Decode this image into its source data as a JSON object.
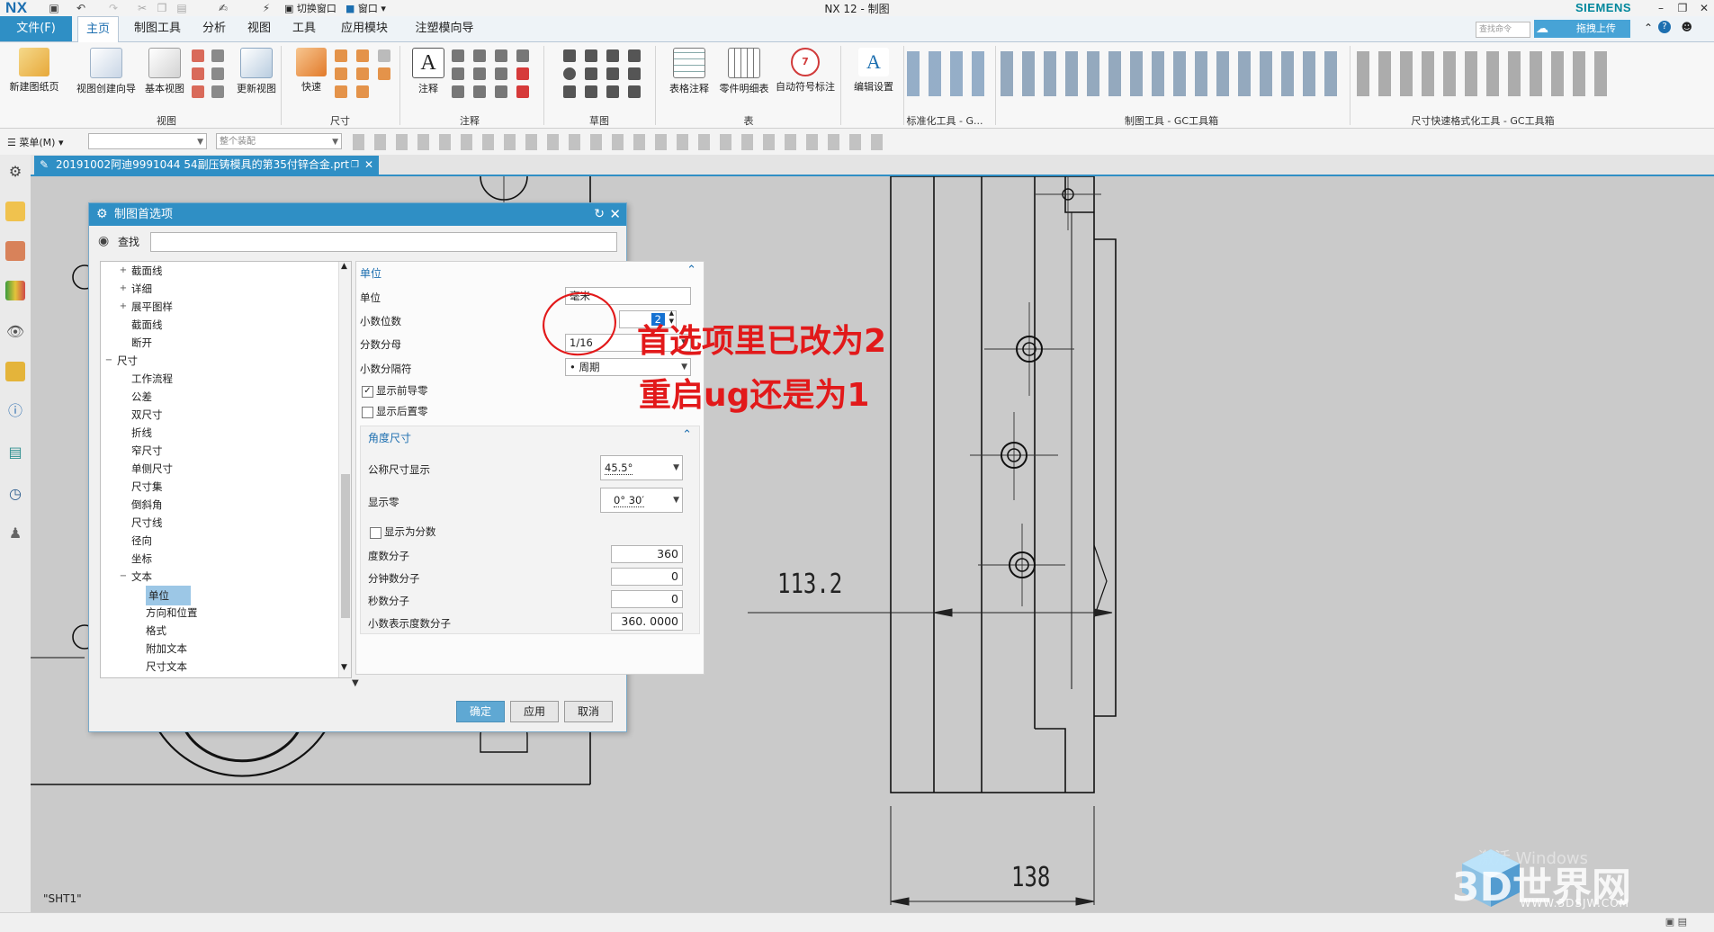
{
  "app": {
    "logo": "NX",
    "title": "NX 12 - 制图",
    "brand": "SIEMENS",
    "search_placeholder": "查找命令",
    "upload_label": "拖拽上传"
  },
  "menu": {
    "file": "文件(F)",
    "tabs": [
      "主页",
      "制图工具",
      "分析",
      "视图",
      "工具",
      "应用模块",
      "注塑模向导"
    ]
  },
  "quick_access": {
    "switch_window": "切换窗口",
    "window": "窗口"
  },
  "ribbon": {
    "items": [
      "新建图纸页",
      "视图创建向导",
      "基本视图",
      "更新视图",
      "快速",
      "注释",
      "表格注释",
      "零件明细表",
      "自动符号标注",
      "编辑设置"
    ],
    "groups": [
      "视图",
      "尺寸",
      "注释",
      "草图",
      "表",
      "标准化工具 - G...",
      "制图工具 - GC工具箱",
      "尺寸快速格式化工具 - GC工具箱"
    ]
  },
  "selbar": {
    "menu": "菜单(M)",
    "filter_value": "",
    "assembly_value": "整个装配"
  },
  "doc_tab": {
    "name": "20191002阿迪9991044  54副压铸模具的第35付锌合金.prt"
  },
  "drawing": {
    "sheet": "\"SHT1\"",
    "dim1": "113.2",
    "dim2": "138"
  },
  "dialog": {
    "title": "制图首选项",
    "find_label": "查找",
    "tree": [
      {
        "label": "截面线",
        "level": 2,
        "toggle": "+"
      },
      {
        "label": "详细",
        "level": 2,
        "toggle": "+"
      },
      {
        "label": "展平图样",
        "level": 2,
        "toggle": "+"
      },
      {
        "label": "截面线",
        "level": 2,
        "toggle": ""
      },
      {
        "label": "断开",
        "level": 2,
        "toggle": ""
      },
      {
        "label": "尺寸",
        "level": 1,
        "toggle": "−"
      },
      {
        "label": "工作流程",
        "level": 2,
        "toggle": ""
      },
      {
        "label": "公差",
        "level": 2,
        "toggle": ""
      },
      {
        "label": "双尺寸",
        "level": 2,
        "toggle": ""
      },
      {
        "label": "折线",
        "level": 2,
        "toggle": ""
      },
      {
        "label": "窄尺寸",
        "level": 2,
        "toggle": ""
      },
      {
        "label": "单侧尺寸",
        "level": 2,
        "toggle": ""
      },
      {
        "label": "尺寸集",
        "level": 2,
        "toggle": ""
      },
      {
        "label": "倒斜角",
        "level": 2,
        "toggle": ""
      },
      {
        "label": "尺寸线",
        "level": 2,
        "toggle": ""
      },
      {
        "label": "径向",
        "level": 2,
        "toggle": ""
      },
      {
        "label": "坐标",
        "level": 2,
        "toggle": ""
      },
      {
        "label": "文本",
        "level": 2,
        "toggle": "−"
      },
      {
        "label": "单位",
        "level": 3,
        "toggle": "",
        "selected": true
      },
      {
        "label": "方向和位置",
        "level": 3,
        "toggle": ""
      },
      {
        "label": "格式",
        "level": 3,
        "toggle": ""
      },
      {
        "label": "附加文本",
        "level": 3,
        "toggle": ""
      },
      {
        "label": "尺寸文本",
        "level": 3,
        "toggle": ""
      }
    ],
    "units_section": "单位",
    "unit_label": "单位",
    "unit_value": "毫米",
    "decimals_label": "小数位数",
    "decimals_value": "2",
    "fraction_label": "分数分母",
    "fraction_value": "1/16",
    "decimal_sep_label": "小数分隔符",
    "decimal_sep_value": "• 周期",
    "show_leading_zero": "显示前导零",
    "show_trailing_zero": "显示后置零",
    "angle_section": "角度尺寸",
    "nominal_label": "公称尺寸显示",
    "nominal_value": "45.5°",
    "zero_label": "显示零",
    "zero_value": "0° 30′",
    "show_fraction": "显示为分数",
    "deg_num_label": "度数分子",
    "deg_num_value": "360",
    "min_num_label": "分钟数分子",
    "min_num_value": "0",
    "sec_num_label": "秒数分子",
    "sec_num_value": "0",
    "dec_deg_label": "小数表示度数分子",
    "dec_deg_value": "360. 0000",
    "ok": "确定",
    "apply": "应用",
    "cancel": "取消"
  },
  "annotation": {
    "line1": "首选项里已改为2",
    "line2": "重启ug还是为1"
  },
  "watermark": {
    "brand": "3D世界网",
    "url": "WWW.3DSJW.COM",
    "windows": "激活 Windows"
  },
  "colors": {
    "accent": "#2f8fc5",
    "annotation": "#e2191a",
    "drawing_bg": "#cacaca"
  }
}
